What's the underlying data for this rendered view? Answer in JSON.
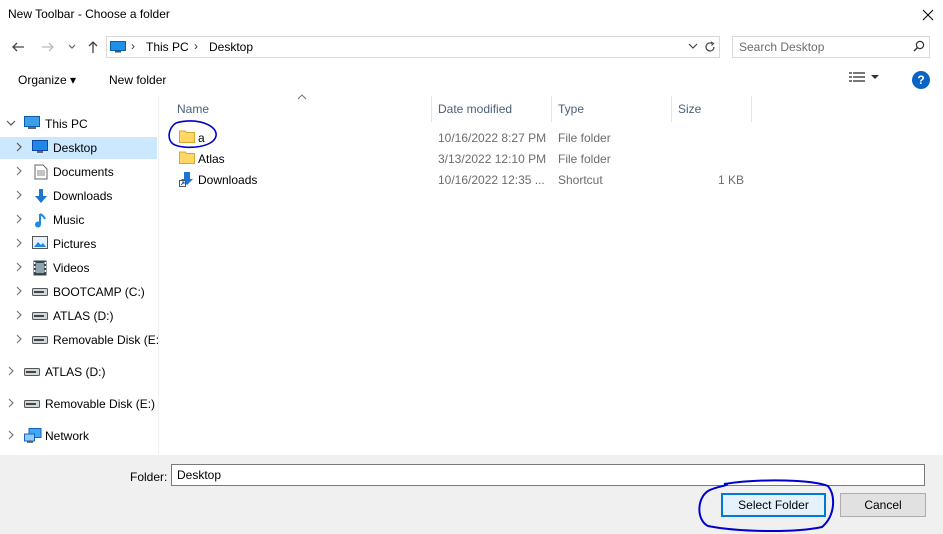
{
  "window": {
    "title": "New Toolbar - Choose a folder"
  },
  "address": {
    "crumbs": [
      "This PC",
      "Desktop"
    ],
    "search_placeholder": "Search Desktop"
  },
  "toolbar": {
    "organize": "Organize ▾",
    "new_folder": "New folder"
  },
  "nav": {
    "items": [
      {
        "label": "This PC",
        "icon": "pc-icon"
      },
      {
        "label": "Desktop",
        "icon": "desktop-icon",
        "selected": true
      },
      {
        "label": "Documents",
        "icon": "documents-icon"
      },
      {
        "label": "Downloads",
        "icon": "downloads-icon"
      },
      {
        "label": "Music",
        "icon": "music-icon"
      },
      {
        "label": "Pictures",
        "icon": "pictures-icon"
      },
      {
        "label": "Videos",
        "icon": "videos-icon"
      },
      {
        "label": "BOOTCAMP (C:)",
        "icon": "drive-icon"
      },
      {
        "label": "ATLAS (D:)",
        "icon": "drive-icon"
      },
      {
        "label": "Removable Disk (E:)",
        "icon": "drive-icon"
      },
      {
        "label": "ATLAS (D:)",
        "icon": "drive-icon"
      },
      {
        "label": "Removable Disk (E:)",
        "icon": "drive-icon"
      },
      {
        "label": "Network",
        "icon": "network-icon"
      }
    ]
  },
  "files": {
    "columns": [
      "Name",
      "Date modified",
      "Type",
      "Size"
    ],
    "rows": [
      {
        "name": "a",
        "date": "10/16/2022 8:27 PM",
        "type": "File folder",
        "size": "",
        "icon": "folder-icon"
      },
      {
        "name": "Atlas",
        "date": "3/13/2022 12:10 PM",
        "type": "File folder",
        "size": "",
        "icon": "folder-icon"
      },
      {
        "name": "Downloads",
        "date": "10/16/2022 12:35 ...",
        "type": "Shortcut",
        "size": "1 KB",
        "icon": "shortcut-icon"
      }
    ]
  },
  "bottom": {
    "folder_label": "Folder:",
    "folder_value": "Desktop",
    "select_label": "Select Folder",
    "cancel_label": "Cancel"
  },
  "colors": {
    "accent": "#0078d7",
    "selection": "#cce8ff",
    "annotation": "#0000cc"
  }
}
